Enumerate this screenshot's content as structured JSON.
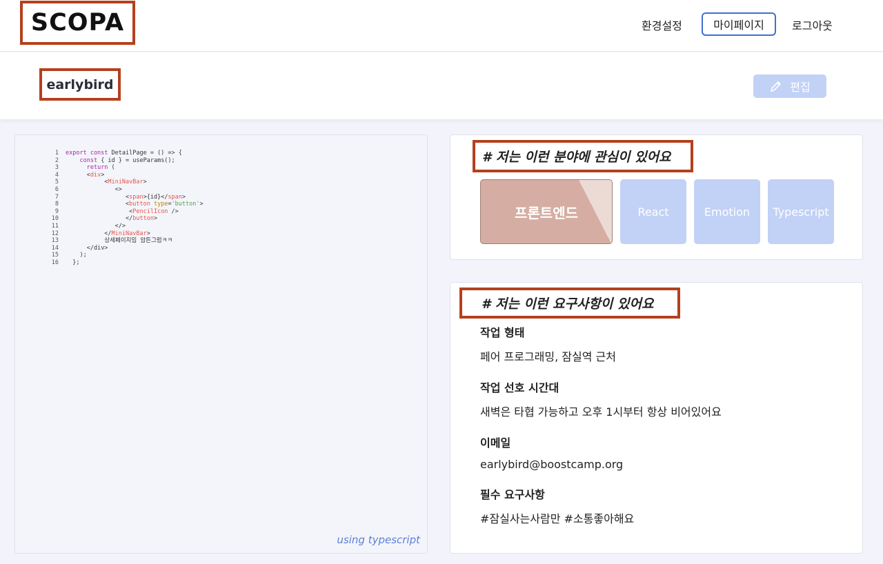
{
  "header": {
    "logo": "SCOPA",
    "nav": {
      "settings": "환경설정",
      "mypage": "마이페이지",
      "logout": "로그아웃"
    }
  },
  "profile": {
    "username": "earlybird",
    "edit_label": "편집"
  },
  "code_panel": {
    "lines": [
      {
        "n": "1"
      },
      {
        "n": "2"
      },
      {
        "n": "3"
      },
      {
        "n": "4"
      },
      {
        "n": "5"
      },
      {
        "n": "6"
      },
      {
        "n": "7"
      },
      {
        "n": "8"
      },
      {
        "n": "9"
      },
      {
        "n": "10"
      },
      {
        "n": "11"
      },
      {
        "n": "12"
      },
      {
        "n": "13"
      },
      {
        "n": "14"
      },
      {
        "n": "15"
      },
      {
        "n": "16"
      }
    ],
    "tokens": {
      "l1_kw": "export const",
      "l1_rest": " DetailPage = () => {",
      "l2_kw": "const",
      "l2_rest": " { id } = useParams();",
      "l3_kw": "return",
      "l3_rest": " (",
      "l4_open": "<",
      "l4_tag": "div",
      "l4_close": ">",
      "l5_open": "<",
      "l5_tag": "MiniNavBar",
      "l5_close": ">",
      "l6": "<>",
      "l7_a": "<",
      "l7_tag": "span",
      "l7_b": ">{id}</",
      "l7_tag2": "span",
      "l7_c": ">",
      "l8_a": "<",
      "l8_tag": "button",
      "l8_attr": " type",
      "l8_eq": "=",
      "l8_str": "'button'",
      "l8_c": ">",
      "l9_a": "<",
      "l9_tag": "PencilIcon",
      "l9_c": " />",
      "l10_a": "</",
      "l10_tag": "button",
      "l10_c": ">",
      "l11": "</>",
      "l12_a": "</",
      "l12_tag": "MiniNavBar",
      "l12_c": ">",
      "l13": "상세페이지임 암튼그럼ㅋㅋ",
      "l14": "</div>",
      "l15": ");",
      "l16": "};"
    },
    "caption": "using typescript"
  },
  "interests": {
    "title": "#  저는 이런 분야에 관심이 있어요",
    "chips": [
      "프론트엔드",
      "React",
      "Emotion",
      "Typescript"
    ]
  },
  "requirements": {
    "title": "#  저는 이런 요구사항이 있어요",
    "items": [
      {
        "label": "작업 형태",
        "value": "페어 프로그래밍, 잠실역 근처"
      },
      {
        "label": "작업 선호 시간대",
        "value": "새벽은 타협 가능하고 오후 1시부터 항상 비어있어요"
      },
      {
        "label": "이메일",
        "value": "earlybird@boostcamp.org"
      },
      {
        "label": "필수 요구사항",
        "value": "#잠실사는사람만 #소통좋아해요"
      }
    ]
  },
  "colors": {
    "accent": "#3f6fd1",
    "highlight_border": "#b5401e",
    "chip": "#c2d1f6",
    "chip_selected": "#d5ada2"
  }
}
